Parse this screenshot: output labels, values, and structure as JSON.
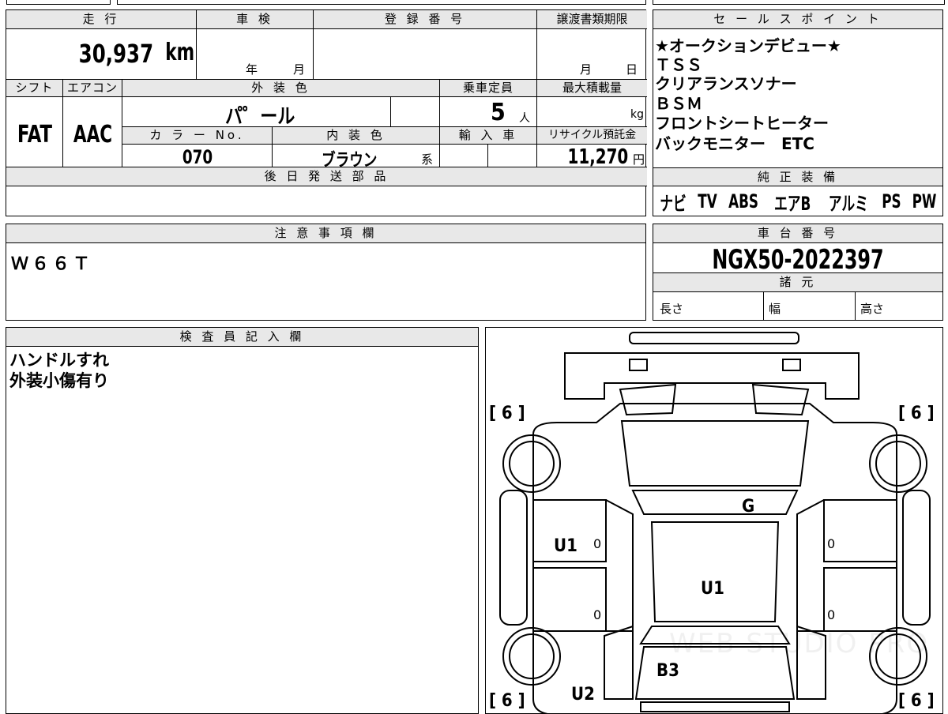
{
  "top_table": {
    "mileage_header": "走 行",
    "mileage_value": "30,937",
    "mileage_unit": "km",
    "inspection_header": "車 検",
    "inspection_year": "年",
    "inspection_month": "月",
    "registration_header": "登 録 番 号",
    "transfer_header": "譲渡書類期限",
    "transfer_month": "月",
    "transfer_day": "日",
    "shift_header": "シフト",
    "aircon_header": "エアコン",
    "exterior_header": "外 装 色",
    "capacity_header": "乗車定員",
    "maxload_header": "最大積載量",
    "shift_value": "FAT",
    "aircon_value": "AAC",
    "exterior_value": "パ゜ール",
    "capacity_value": "5",
    "capacity_unit": "人",
    "maxload_unit": "kg",
    "color_no_header": "カ ラ ー No.",
    "interior_header": "内 装 色",
    "import_header": "輸 入 車",
    "recycle_header": "リサイクル預託金",
    "color_no_value": "070",
    "interior_value": "ブラウン",
    "interior_suffix": "系",
    "recycle_value": "11,270",
    "recycle_unit": "円",
    "later_parts_header": "後 日 発 送 部 品"
  },
  "sales_points": {
    "header": "セ ー ル ス ポ イ ン ト",
    "lines": [
      "★オークションデビュー★",
      "ＴＳＳ",
      "クリアランスソナー",
      "ＢＳＭ",
      "フロントシートヒーター",
      "バックモニター　ETC"
    ]
  },
  "equipment": {
    "header": "純 正 装 備",
    "items": [
      "ナビ",
      "TV",
      "ABS",
      "エアB",
      "アルミ",
      "PS",
      "PW"
    ]
  },
  "notes": {
    "header": "注 意 事 項 欄",
    "text": "Ｗ６６Ｔ"
  },
  "chassis": {
    "header": "車 台 番 号",
    "value": "NGX50-2022397",
    "spec_header": "諸 元",
    "length_label": "長さ",
    "width_label": "幅",
    "height_label": "高さ"
  },
  "inspector": {
    "header": "検 査 員 記 入 欄",
    "lines": [
      "ハンドルすれ",
      "外装小傷有り"
    ]
  },
  "diagram": {
    "tire_marks": [
      "[ 6 ]",
      "[ 6 ]",
      "[ 6 ]",
      "[ 6 ]"
    ],
    "labels": {
      "hood": "G",
      "left_front_door": "U1",
      "roof": "U1",
      "rear": "B3",
      "left_rear": "U2",
      "door_zero_1": "0",
      "door_zero_2": "0",
      "door_zero_3": "0",
      "door_zero_4": "0"
    },
    "watermark": "WEB STUDIO PRO"
  }
}
